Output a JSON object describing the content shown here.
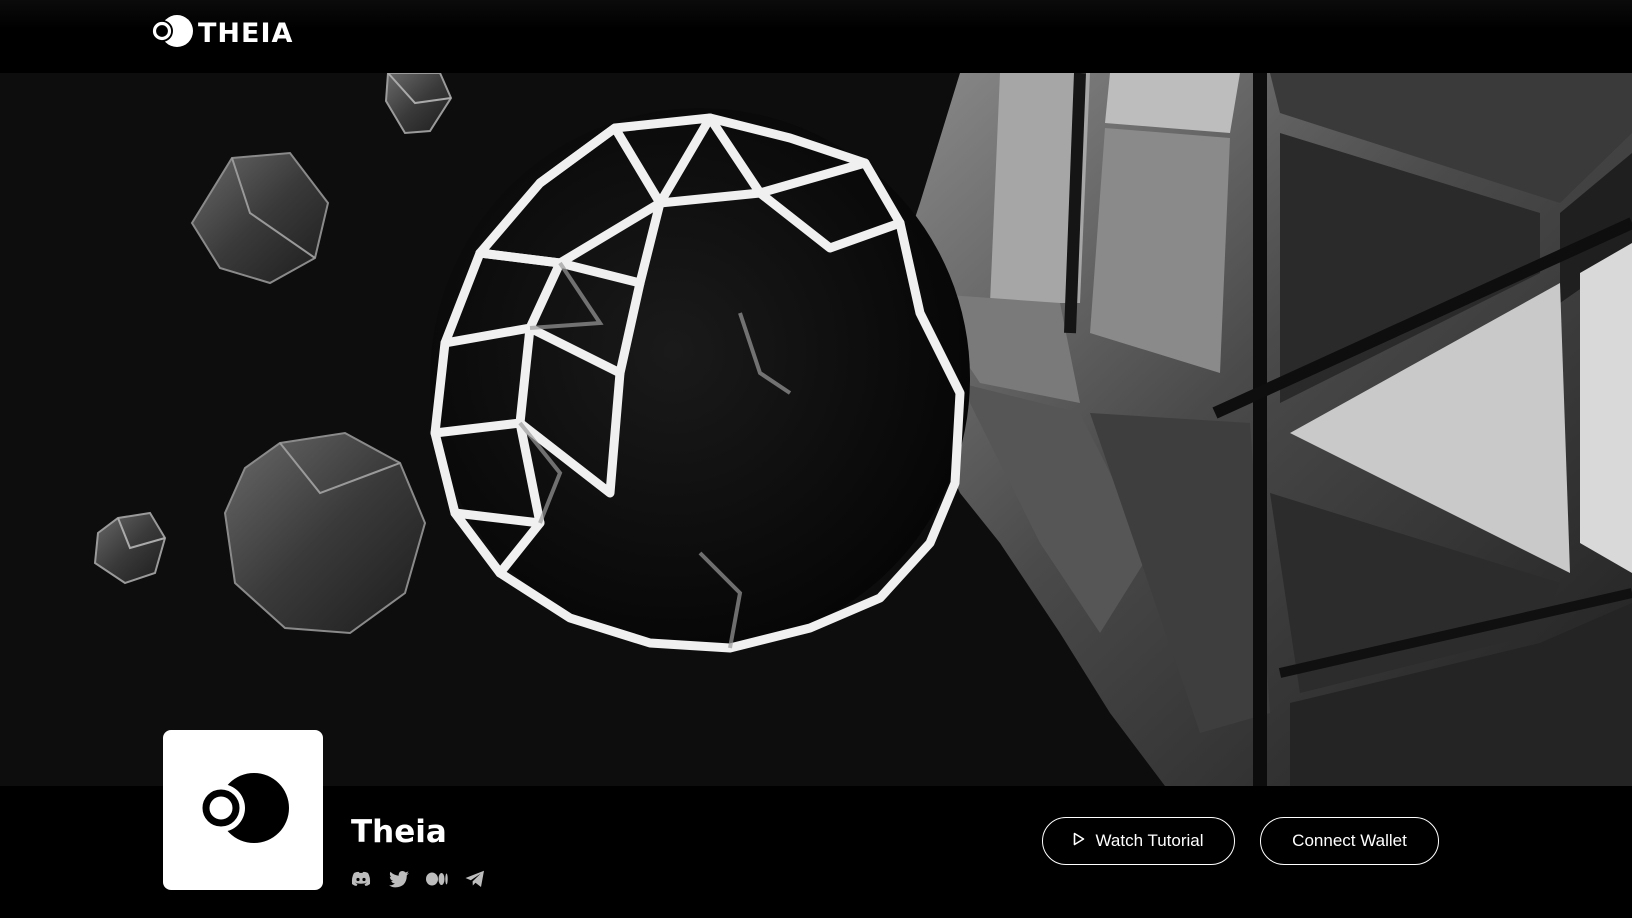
{
  "header": {
    "logo_text": "THEIA",
    "logo_icon": "theia-logo-icon"
  },
  "hero": {
    "image_description_icon": "geometric-spheres-artwork"
  },
  "project": {
    "name": "Theia",
    "avatar_icon": "theia-logo-icon",
    "socials": [
      {
        "name": "Discord",
        "icon": "discord-icon"
      },
      {
        "name": "Twitter",
        "icon": "twitter-icon"
      },
      {
        "name": "Medium",
        "icon": "medium-icon"
      },
      {
        "name": "Telegram",
        "icon": "telegram-icon"
      }
    ]
  },
  "actions": {
    "watch_tutorial_label": "Watch Tutorial",
    "watch_tutorial_icon": "play-icon",
    "connect_wallet_label": "Connect Wallet"
  },
  "colors": {
    "background": "#000000",
    "hero_background": "#0d0d0d",
    "accent": "#ffffff"
  }
}
